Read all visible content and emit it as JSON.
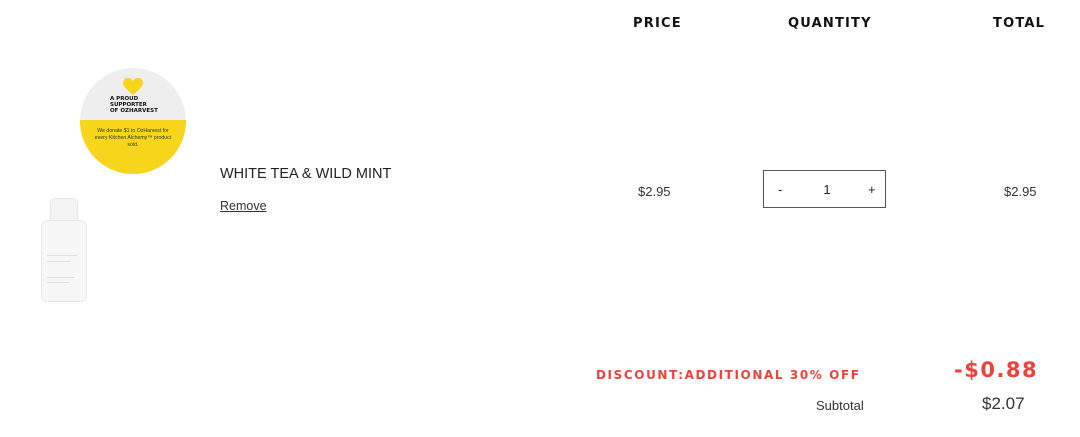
{
  "table": {
    "headers": {
      "price": "PRICE",
      "quantity": "QUANTITY",
      "total": "TOTAL"
    }
  },
  "promo_badge": {
    "title": "A PROUD\nSUPPORTER\nOF OZHARVEST",
    "text": "We donate $1 to OzHarvest for every Kitchen Alchemy™ product sold.",
    "colors": {
      "yellow": "#f7d51b",
      "circle_bg": "#eeeeee"
    },
    "icon": "heart-icon"
  },
  "item": {
    "name": "WHITE TEA & WILD MINT",
    "remove_label": "Remove",
    "price": "$2.95",
    "quantity": {
      "minus_label": "-",
      "value": "1",
      "plus_label": "+"
    },
    "total": "$2.95"
  },
  "summary": {
    "discount_label": "DISCOUNT:ADDITIONAL 30% OFF",
    "discount_amount": "-$0.88",
    "subtotal_label": "Subtotal",
    "subtotal_amount": "$2.07",
    "accent_color": "#f0413b"
  }
}
